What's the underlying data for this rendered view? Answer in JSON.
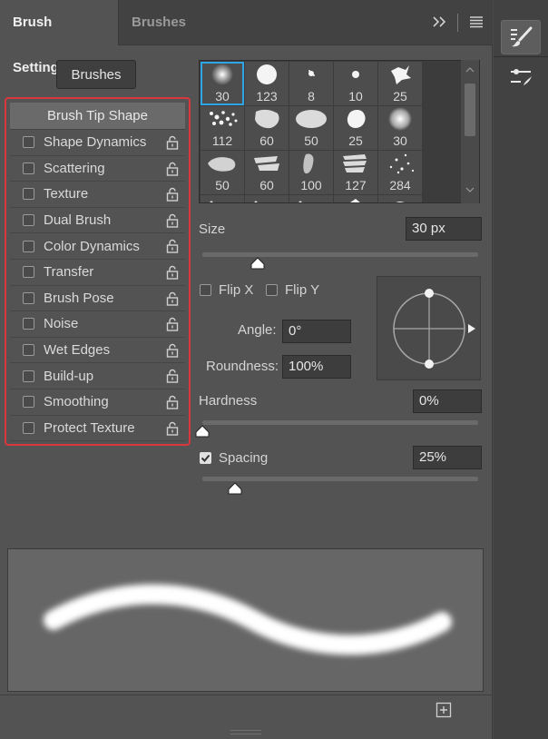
{
  "tabs": [
    {
      "label": "Brush Settings",
      "active": true
    },
    {
      "label": "Brushes",
      "active": false
    }
  ],
  "tab_tools": {
    "collapse_icon": "double-chevron-right-icon",
    "menu_icon": "hamburger-menu-icon"
  },
  "dock": {
    "items": [
      {
        "icon": "brush-settings-icon",
        "active": true
      },
      {
        "icon": "brush-presets-icon",
        "active": false
      }
    ]
  },
  "brushes_button": "Brushes",
  "options": {
    "header": "Brush Tip Shape",
    "items": [
      {
        "label": "Shape Dynamics",
        "checked": false
      },
      {
        "label": "Scattering",
        "checked": false
      },
      {
        "label": "Texture",
        "checked": false
      },
      {
        "label": "Dual Brush",
        "checked": false
      },
      {
        "label": "Color Dynamics",
        "checked": false
      },
      {
        "label": "Transfer",
        "checked": false
      },
      {
        "label": "Brush Pose",
        "checked": false
      },
      {
        "label": "Noise",
        "checked": false
      },
      {
        "label": "Wet Edges",
        "checked": false
      },
      {
        "label": "Build-up",
        "checked": false
      },
      {
        "label": "Smoothing",
        "checked": false
      },
      {
        "label": "Protect Texture",
        "checked": false
      }
    ]
  },
  "brush_grid": {
    "selected_index": 0,
    "rows": [
      [
        {
          "size": "30",
          "shape": "soft-round"
        },
        {
          "size": "123",
          "shape": "hard-round"
        },
        {
          "size": "8",
          "shape": "tiny-splatter"
        },
        {
          "size": "10",
          "shape": "small-dot"
        },
        {
          "size": "25",
          "shape": "splatter"
        }
      ],
      [
        {
          "size": "112",
          "shape": "speckle"
        },
        {
          "size": "60",
          "shape": "chalk"
        },
        {
          "size": "50",
          "shape": "oval-grain"
        },
        {
          "size": "25",
          "shape": "blob"
        },
        {
          "size": "30",
          "shape": "soft-cloud"
        }
      ],
      [
        {
          "size": "50",
          "shape": "spray"
        },
        {
          "size": "60",
          "shape": "rough-strokes"
        },
        {
          "size": "100",
          "shape": "charcoal"
        },
        {
          "size": "127",
          "shape": "leaf-strokes"
        },
        {
          "size": "284",
          "shape": "scatter-dots"
        }
      ]
    ]
  },
  "size": {
    "label": "Size",
    "value": "30 px",
    "slider": 0.2
  },
  "flip": {
    "x_label": "Flip X",
    "y_label": "Flip Y",
    "x_checked": false,
    "y_checked": false
  },
  "angle": {
    "label": "Angle:",
    "value": "0°"
  },
  "roundness": {
    "label": "Roundness:",
    "value": "100%"
  },
  "hardness": {
    "label": "Hardness",
    "value": "0%",
    "slider": 0.0
  },
  "spacing": {
    "label": "Spacing",
    "value": "25%",
    "checked": true,
    "slider": 0.12
  },
  "preview": {
    "stroke_color": "#ffffff"
  },
  "footer": {
    "add_icon": "add-new-preset-icon"
  },
  "colors": {
    "accent": "#30a5e6",
    "highlight": "#d9373c"
  }
}
